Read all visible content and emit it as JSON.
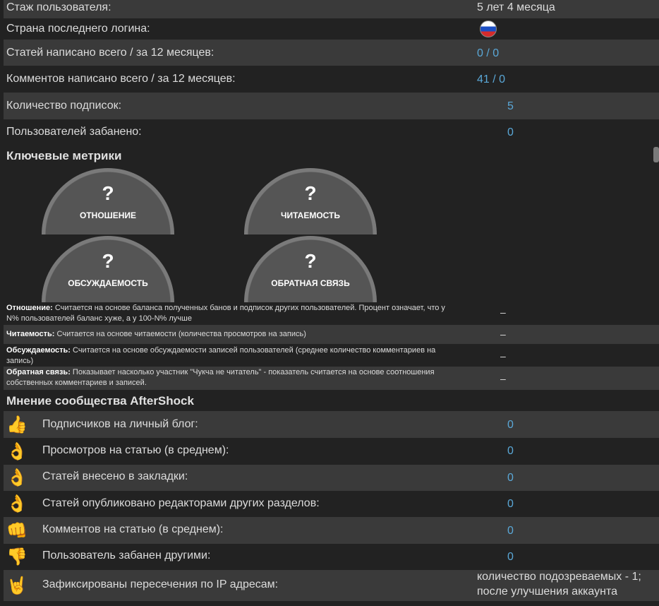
{
  "stats": [
    {
      "label": "Стаж пользователя:",
      "value": "5 лет 4 месяца",
      "color": "white"
    },
    {
      "label": "Страна последнего логина:",
      "value": "",
      "color": "flag"
    },
    {
      "label": "Статей написано всего / за 12 месяцев:",
      "value": "0 / 0",
      "color": "blue"
    },
    {
      "label": "Комментов написано всего / за 12 месяцев:",
      "value": "41 / 0",
      "color": "blue"
    },
    {
      "label": "Количество подписок:",
      "value": "5",
      "color": "blue"
    },
    {
      "label": "Пользователей забанено:",
      "value": "0",
      "color": "blue"
    }
  ],
  "key_metrics": {
    "title": "Ключевые метрики",
    "gauges": [
      {
        "symbol": "?",
        "name": "ОТНОШЕНИЕ"
      },
      {
        "symbol": "?",
        "name": "ЧИТАЕМОСТЬ"
      },
      {
        "symbol": "?",
        "name": "ОБСУЖДАЕМОСТЬ"
      },
      {
        "symbol": "?",
        "name": "ОБРАТНАЯ СВЯЗЬ"
      }
    ],
    "descriptions": [
      {
        "term": "Отношение:",
        "text": " Считается на основе баланса полученных банов и подписок других пользователей. Процент означает, что у N% пользователей баланс хуже, а у 100-N% лучше",
        "value": "–"
      },
      {
        "term": "Читаемость:",
        "text": " Считается на основе читаемости (количества просмотров на запись)",
        "value": "–"
      },
      {
        "term": "Обсуждаемость:",
        "text": " Считается на основе обсуждаемости записей пользователей (среднее количество комментариев на запись)",
        "value": "–"
      },
      {
        "term": "Обратная связь:",
        "text": " Показывает насколько участник \"Чукча не читатель\" - показатель считается на основе соотношения собственных комментариев и записей.",
        "value": "–"
      }
    ]
  },
  "community": {
    "title": "Мнение сообщества AfterShock",
    "rows": [
      {
        "icon": "thumbs-up-icon",
        "glyph": "👍",
        "label": "Подписчиков на личный блог:",
        "value": "0"
      },
      {
        "icon": "ok-hand-icon",
        "glyph": "👌",
        "label": "Просмотров на статью (в среднем):",
        "value": "0"
      },
      {
        "icon": "ok-hand-icon",
        "glyph": "👌",
        "label": "Статей внесено в закладки:",
        "value": "0"
      },
      {
        "icon": "ok-hand-icon",
        "glyph": "👌",
        "label": "Статей опубликовано редакторами других разделов:",
        "value": "0"
      },
      {
        "icon": "fist-icon",
        "glyph": "👊",
        "label": "Комментов на статью (в среднем):",
        "value": "0"
      },
      {
        "icon": "thumbs-down-icon",
        "glyph": "👎",
        "label": "Пользователь забанен другими:",
        "value": "0"
      },
      {
        "icon": "rock-hand-icon",
        "glyph": "🤘",
        "label": "Зафиксированы пересечения по IP адресам:",
        "value_line1": "количество подозреваемых - 1;",
        "value_line2": "после улучшения аккаунта"
      }
    ]
  }
}
